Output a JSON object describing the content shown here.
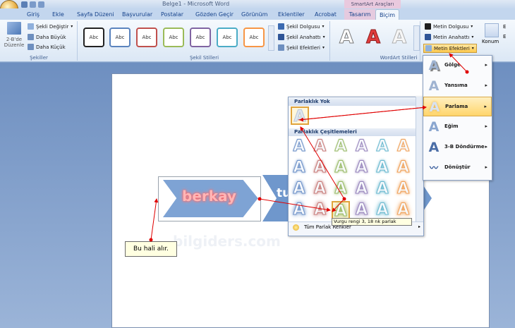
{
  "window": {
    "title": "Belge1 - Microsoft Word",
    "contextual_title": "SmartArt Araçları"
  },
  "tabs": [
    {
      "label": "Giriş"
    },
    {
      "label": "Ekle"
    },
    {
      "label": "Sayfa Düzeni"
    },
    {
      "label": "Başvurular"
    },
    {
      "label": "Postalar"
    },
    {
      "label": "Gözden Geçir"
    },
    {
      "label": "Görünüm"
    },
    {
      "label": "Eklentiler"
    },
    {
      "label": "Acrobat"
    },
    {
      "label": "Tasarım"
    },
    {
      "label": "Biçim"
    }
  ],
  "shapes_group": {
    "label": "Şekiller",
    "edit_2d": "2-B'de Düzenle",
    "change_shape": "Şekli Değiştir",
    "larger": "Daha Büyük",
    "smaller": "Daha Küçük"
  },
  "shape_styles": {
    "label": "Şekil Stilleri",
    "thumb_text": "Abc",
    "fill": "Şekil Dolgusu",
    "outline": "Şekil Anahattı",
    "effects": "Şekil Efektleri"
  },
  "wordart_styles": {
    "label": "WordArt Stilleri",
    "text_fill": "Metin Dolgusu",
    "text_outline": "Metin Anahattı",
    "text_effects": "Metin Efektleri",
    "letter": "A"
  },
  "arrange": {
    "position": "Konum",
    "e1": "E",
    "e2": "E"
  },
  "effects_menu": [
    {
      "label": "Gölge"
    },
    {
      "label": "Yansıma"
    },
    {
      "label": "Parlama"
    },
    {
      "label": "Eğim"
    },
    {
      "label": "3-B Döndürme"
    },
    {
      "label": "Dönüştür"
    }
  ],
  "glow_gallery": {
    "no_glow_header": "Parlaklık Yok",
    "variations_header": "Parlaklık Çeşitlemeleri",
    "more_colors": "Tüm Parlak Renkler",
    "tooltip": "Vurgu rengi 3, 18 nk parlak",
    "letter": "A",
    "glow_colors": [
      "#6f93c9",
      "#c87d7b",
      "#9bbc6a",
      "#9987bd",
      "#6cbad0",
      "#f0a25a"
    ]
  },
  "document": {
    "smartart_text_1": "berkay",
    "smartart_text_2": "tu",
    "watermark": "bilgiders.com",
    "callout": "Bu hali alır."
  },
  "colors": {
    "ribbon_text": "#15428b",
    "accent_red": "#e00000",
    "chevron": "#6f97cc"
  }
}
